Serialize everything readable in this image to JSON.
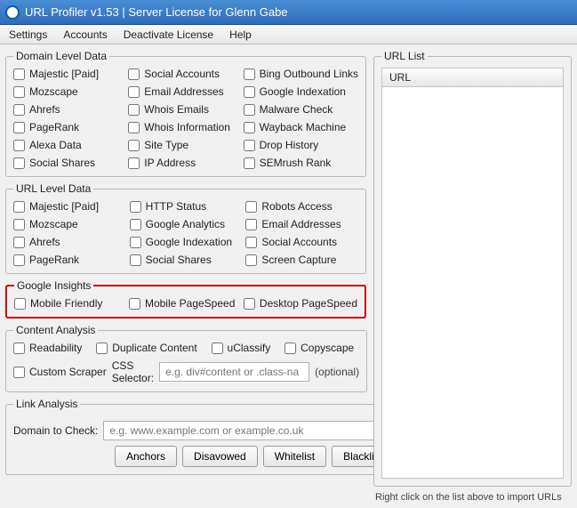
{
  "window": {
    "title": "URL Profiler v1.53 | Server License for Glenn Gabe"
  },
  "menu": {
    "settings": "Settings",
    "accounts": "Accounts",
    "deactivate": "Deactivate License",
    "help": "Help"
  },
  "group_domain": {
    "legend": "Domain Level Data",
    "c1": [
      "Majestic [Paid]",
      "Mozscape",
      "Ahrefs",
      "PageRank",
      "Alexa Data",
      "Social Shares"
    ],
    "c2": [
      "Social Accounts",
      "Email Addresses",
      "Whois Emails",
      "Whois Information",
      "Site Type",
      "IP Address"
    ],
    "c3": [
      "Bing Outbound Links",
      "Google Indexation",
      "Malware Check",
      "Wayback Machine",
      "Drop History",
      "SEMrush Rank"
    ]
  },
  "group_url": {
    "legend": "URL Level Data",
    "c1": [
      "Majestic [Paid]",
      "Mozscape",
      "Ahrefs",
      "PageRank"
    ],
    "c2": [
      "HTTP Status",
      "Google Analytics",
      "Google Indexation",
      "Social Shares"
    ],
    "c3": [
      "Robots Access",
      "Email Addresses",
      "Social Accounts",
      "Screen Capture"
    ]
  },
  "group_insights": {
    "legend": "Google Insights",
    "items": [
      "Mobile Friendly",
      "Mobile PageSpeed",
      "Desktop PageSpeed"
    ]
  },
  "group_content": {
    "legend": "Content Analysis",
    "row1": [
      "Readability",
      "Duplicate Content",
      "uClassify",
      "Copyscape"
    ],
    "custom_scraper": "Custom Scraper",
    "css_selector_label": "CSS Selector:",
    "css_selector_placeholder": "e.g. div#content or .class-na",
    "optional": "(optional)"
  },
  "group_link": {
    "legend": "Link Analysis",
    "domain_label": "Domain to Check:",
    "domain_placeholder": "e.g. www.example.com or example.co.uk",
    "buttons": [
      "Anchors",
      "Disavowed",
      "Whitelist",
      "Blacklist"
    ]
  },
  "urllist": {
    "legend": "URL List",
    "col_header": "URL",
    "hint": "Right click on the list above to import URLs"
  }
}
